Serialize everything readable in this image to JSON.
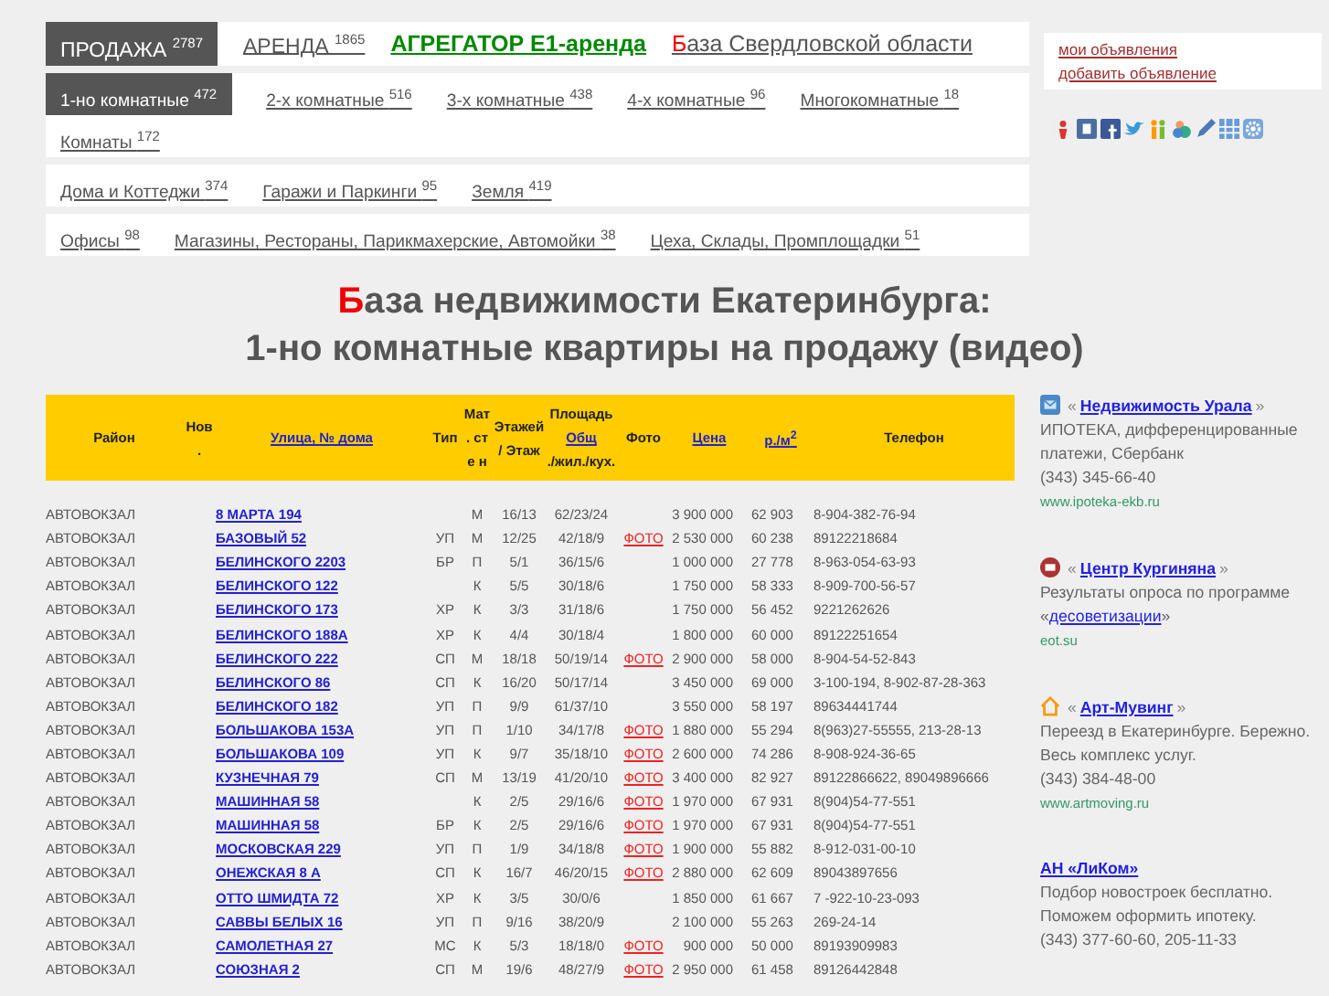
{
  "main_tabs": [
    {
      "label": "ПРОДАЖА",
      "count": "2787",
      "selected": true
    },
    {
      "label": "АРЕНДА",
      "count": "1865",
      "selected": false
    }
  ],
  "aggregator_link": "АГРЕГАТОР Е1-аренда",
  "region_link": {
    "initial": "Б",
    "rest": "аза Свердловской области"
  },
  "category_rows": [
    [
      {
        "label": "1-но комнатные",
        "count": "472",
        "selected": true
      },
      {
        "label": "2-х комнатные",
        "count": "516",
        "selected": false
      },
      {
        "label": "3-х комнатные",
        "count": "438",
        "selected": false
      },
      {
        "label": "4-х комнатные",
        "count": "96",
        "selected": false
      },
      {
        "label": "Многокомнатные",
        "count": "18",
        "selected": false
      },
      {
        "label": "Комнаты",
        "count": "172",
        "selected": false
      }
    ],
    [
      {
        "label": "Дома и Коттеджи",
        "count": "374",
        "selected": false
      },
      {
        "label": "Гаражи и Паркинги",
        "count": "95",
        "selected": false
      },
      {
        "label": "Земля",
        "count": "419",
        "selected": false
      }
    ],
    [
      {
        "label": "Офисы",
        "count": "98",
        "selected": false
      },
      {
        "label": "Магазины, Рестораны, Парикмахерские, Автомойки",
        "count": "38",
        "selected": false
      },
      {
        "label": "Цеха, Склады, Промплощадки",
        "count": "51",
        "selected": false
      }
    ]
  ],
  "account_links": [
    "мои объявления",
    "добавить объявление"
  ],
  "heading": {
    "initial": "Б",
    "rest": "аза недвижимости Екатеринбурга:",
    "line2": "1-но комнатные квартиры на продажу (видео)"
  },
  "table": {
    "columns": [
      {
        "label": "Район",
        "link": false
      },
      {
        "label": "Нов .",
        "link": false
      },
      {
        "label": "Улица, № дома",
        "link": true
      },
      {
        "label": "Тип",
        "link": false
      },
      {
        "label": "Мат . сте н",
        "link": false
      },
      {
        "label": "Этажей / Этаж",
        "link": false
      },
      {
        "label": "Площадь",
        "sub_link": "Общ",
        "sub": "./жил./кух."
      },
      {
        "label": "Фото",
        "link": false
      },
      {
        "label": "Цена",
        "link": true
      },
      {
        "label": "р./м$^{2}$",
        "link": true
      },
      {
        "label": "Телефон",
        "link": false
      }
    ],
    "rows": [
      [
        "АВТОВОКЗАЛ",
        "",
        "8 МАРТА  194",
        "",
        "М",
        "16/13",
        "62/23/24",
        "",
        "3 900 000",
        "62 903",
        "8-904-382-76-94"
      ],
      [
        "АВТОВОКЗАЛ",
        "",
        "БАЗОВЫЙ  52",
        "УП",
        "М",
        "12/25",
        "42/18/9",
        "ФОТО",
        "2 530 000",
        "60 238",
        "89122218684"
      ],
      [
        "АВТОВОКЗАЛ",
        "",
        "БЕЛИНСКОГО  2203",
        "БР",
        "П",
        "5/1",
        "36/15/6",
        "",
        "1 000 000",
        "27 778",
        "8-963-054-63-93"
      ],
      [
        "АВТОВОКЗАЛ",
        "",
        "БЕЛИНСКОГО  122",
        "",
        "К",
        "5/5",
        "30/18/6",
        "",
        "1 750 000",
        "58 333",
        "8-909-700-56-57"
      ],
      [
        "АВТОВОКЗАЛ",
        "",
        "БЕЛИНСКОГО  173",
        "ХР",
        "К",
        "3/3",
        "31/18/6",
        "",
        "1 750 000",
        "56 452",
        "9221262626"
      ],
      [
        "АВТОВОКЗАЛ",
        "",
        "БЕЛИНСКОГО  188А",
        "ХР",
        "К",
        "4/4",
        "30/18/4",
        "",
        "1 800 000",
        "60 000",
        "89122251654"
      ],
      [
        "АВТОВОКЗАЛ",
        "",
        "БЕЛИНСКОГО  222",
        "СП",
        "М",
        "18/18",
        "50/19/14",
        "ФОТО",
        "2 900 000",
        "58 000",
        "8-904-54-52-843"
      ],
      [
        "АВТОВОКЗАЛ",
        "",
        "БЕЛИНСКОГО  86",
        "СП",
        "К",
        "16/20",
        "50/17/14",
        "",
        "3 450 000",
        "69 000",
        "3-100-194, 8-902-87-28-363"
      ],
      [
        "АВТОВОКЗАЛ",
        "",
        "БЕЛИНСКОГО  182",
        "УП",
        "П",
        "9/9",
        "61/37/10",
        "",
        "3 550 000",
        "58 197",
        "89634441744"
      ],
      [
        "АВТОВОКЗАЛ",
        "",
        "БОЛЬШАКОВА  153А",
        "УП",
        "П",
        "1/10",
        "34/17/8",
        "ФОТО",
        "1 880 000",
        "55 294",
        "8(963)27-55555, 213-28-13"
      ],
      [
        "АВТОВОКЗАЛ",
        "",
        "БОЛЬШАКОВА  109",
        "УП",
        "К",
        "9/7",
        "35/18/10",
        "ФОТО",
        "2 600 000",
        "74 286",
        "8-908-924-36-65"
      ],
      [
        "АВТОВОКЗАЛ",
        "",
        "КУЗНЕЧНАЯ  79",
        "СП",
        "М",
        "13/19",
        "41/20/10",
        "ФОТО",
        "3 400 000",
        "82 927",
        "89122866622, 89049896666"
      ],
      [
        "АВТОВОКЗАЛ",
        "",
        "МАШИННАЯ  58",
        "",
        "К",
        "2/5",
        "29/16/6",
        "ФОТО",
        "1 970 000",
        "67 931",
        "8(904)54-77-551"
      ],
      [
        "АВТОВОКЗАЛ",
        "",
        "МАШИННАЯ  58",
        "БР",
        "К",
        "2/5",
        "29/16/6",
        "ФОТО",
        "1 970 000",
        "67 931",
        "8(904)54-77-551"
      ],
      [
        "АВТОВОКЗАЛ",
        "",
        "МОСКОВСКАЯ  229",
        "УП",
        "П",
        "1/9",
        "34/18/8",
        "ФОТО",
        "1 900 000",
        "55 882",
        "8-912-031-00-10"
      ],
      [
        "АВТОВОКЗАЛ",
        "",
        "ОНЕЖСКАЯ  8 А",
        "СП",
        "К",
        "16/7",
        "46/20/15",
        "ФОТО",
        "2 880 000",
        "62 609",
        "89043897656"
      ],
      [
        "АВТОВОКЗАЛ",
        "",
        "ОТТО ШМИДТА  72",
        "ХР",
        "К",
        "3/5",
        "30/0/6",
        "",
        "1 850 000",
        "61 667",
        "7 -922-10-23-093"
      ],
      [
        "АВТОВОКЗАЛ",
        "",
        "САВВЫ БЕЛЫХ  16",
        "УП",
        "П",
        "9/16",
        "38/20/9",
        "",
        "2 100 000",
        "55 263",
        "269-24-14"
      ],
      [
        "АВТОВОКЗАЛ",
        "",
        "САМОЛЕТНАЯ  27",
        "МС",
        "К",
        "5/3",
        "18/18/0",
        "ФОТО",
        "900 000",
        "50 000",
        "89193909983"
      ],
      [
        "АВТОВОКЗАЛ",
        "",
        "СОЮЗНАЯ  2",
        "СП",
        "М",
        "19/6",
        "48/27/9",
        "ФОТО",
        "2 950 000",
        "61 458",
        "89126442848"
      ]
    ]
  },
  "ads": [
    {
      "before": "«",
      "title": "Недвижимость Урала",
      "after": "»",
      "text": [
        {
          "t": "ИПОТЕКА, дифференцированные платежи, Сбербанк",
          "kind": "text"
        }
      ],
      "phone": "(343) 345-66-40",
      "url": "www.ipoteka-ekb.ru"
    },
    {
      "before": "«",
      "title": "Центр Кургиняна",
      "after": "»",
      "text": [
        {
          "t": "Результаты опроса по программе «",
          "kind": "text"
        },
        {
          "t": "десоветизации",
          "kind": "link"
        },
        {
          "t": "»",
          "kind": "text"
        }
      ],
      "url": "eot.su"
    },
    {
      "before": "«",
      "title": "Арт-Мувинг",
      "after": "»",
      "text": [
        {
          "t": "Переезд в Екатеринбурге. Бережно. Весь комплекс услуг.",
          "kind": "text"
        }
      ],
      "phone": "(343) 384-48-00",
      "url": "www.artmoving.ru"
    },
    {
      "title": "АН «ЛиКом»",
      "text": [
        {
          "t": "Подбор новостроек бесплатно. Поможем оформить ипотеку.",
          "kind": "text"
        }
      ],
      "phone": "(343) 377-60-60, 205-11-33"
    }
  ]
}
